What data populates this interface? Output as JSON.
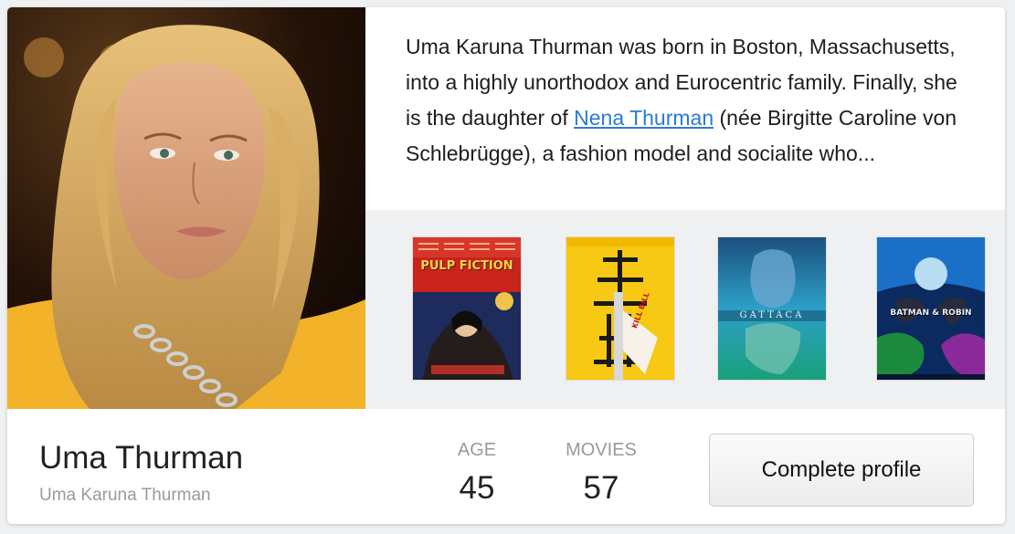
{
  "profile": {
    "name": "Uma Thurman",
    "full_name": "Uma Karuna Thurman"
  },
  "bio": {
    "text_before": "Uma Karuna Thurman was born in Boston, Massachusetts, into a highly unorthodox and Eurocentric family. Finally, she is the daughter of ",
    "link_text": "Nena Thurman",
    "text_after": " (née Birgitte Caroline von Schlebrügge), a fashion model and socialite who..."
  },
  "stats": {
    "age_label": "AGE",
    "age_value": "45",
    "movies_label": "MOVIES",
    "movies_value": "57"
  },
  "actions": {
    "complete_profile_label": "Complete profile"
  },
  "movies": [
    {
      "title": "Pulp Fiction",
      "poster_text": "PULP FICTION"
    },
    {
      "title": "Kill Bill",
      "poster_text": "KILL BILL"
    },
    {
      "title": "Gattaca",
      "poster_text": "GATTACA"
    },
    {
      "title": "Batman & Robin",
      "poster_text": "BATMAN & ROBIN"
    }
  ],
  "colors": {
    "link": "#2a7ad6",
    "muted": "#9a9a9a",
    "strip_background": "#eff0f1"
  }
}
